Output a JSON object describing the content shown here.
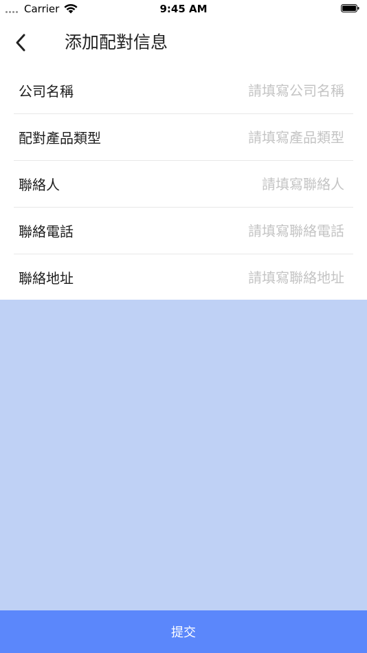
{
  "status_bar": {
    "carrier": "Carrier",
    "time": "9:45 AM"
  },
  "nav": {
    "title": "添加配對信息"
  },
  "form": {
    "rows": [
      {
        "label": "公司名稱",
        "placeholder": "請填寫公司名稱",
        "value": ""
      },
      {
        "label": "配對產品類型",
        "placeholder": "請填寫產品類型",
        "value": ""
      },
      {
        "label": "聯絡人",
        "placeholder": "請填寫聯絡人",
        "value": ""
      },
      {
        "label": "聯絡電話",
        "placeholder": "請填寫聯絡電話",
        "value": ""
      },
      {
        "label": "聯絡地址",
        "placeholder": "請填寫聯絡地址",
        "value": ""
      }
    ]
  },
  "submit": {
    "label": "提交"
  },
  "colors": {
    "accent": "#5b87fb",
    "panel": "#bfd1f5",
    "placeholder": "#c4c4c4"
  }
}
